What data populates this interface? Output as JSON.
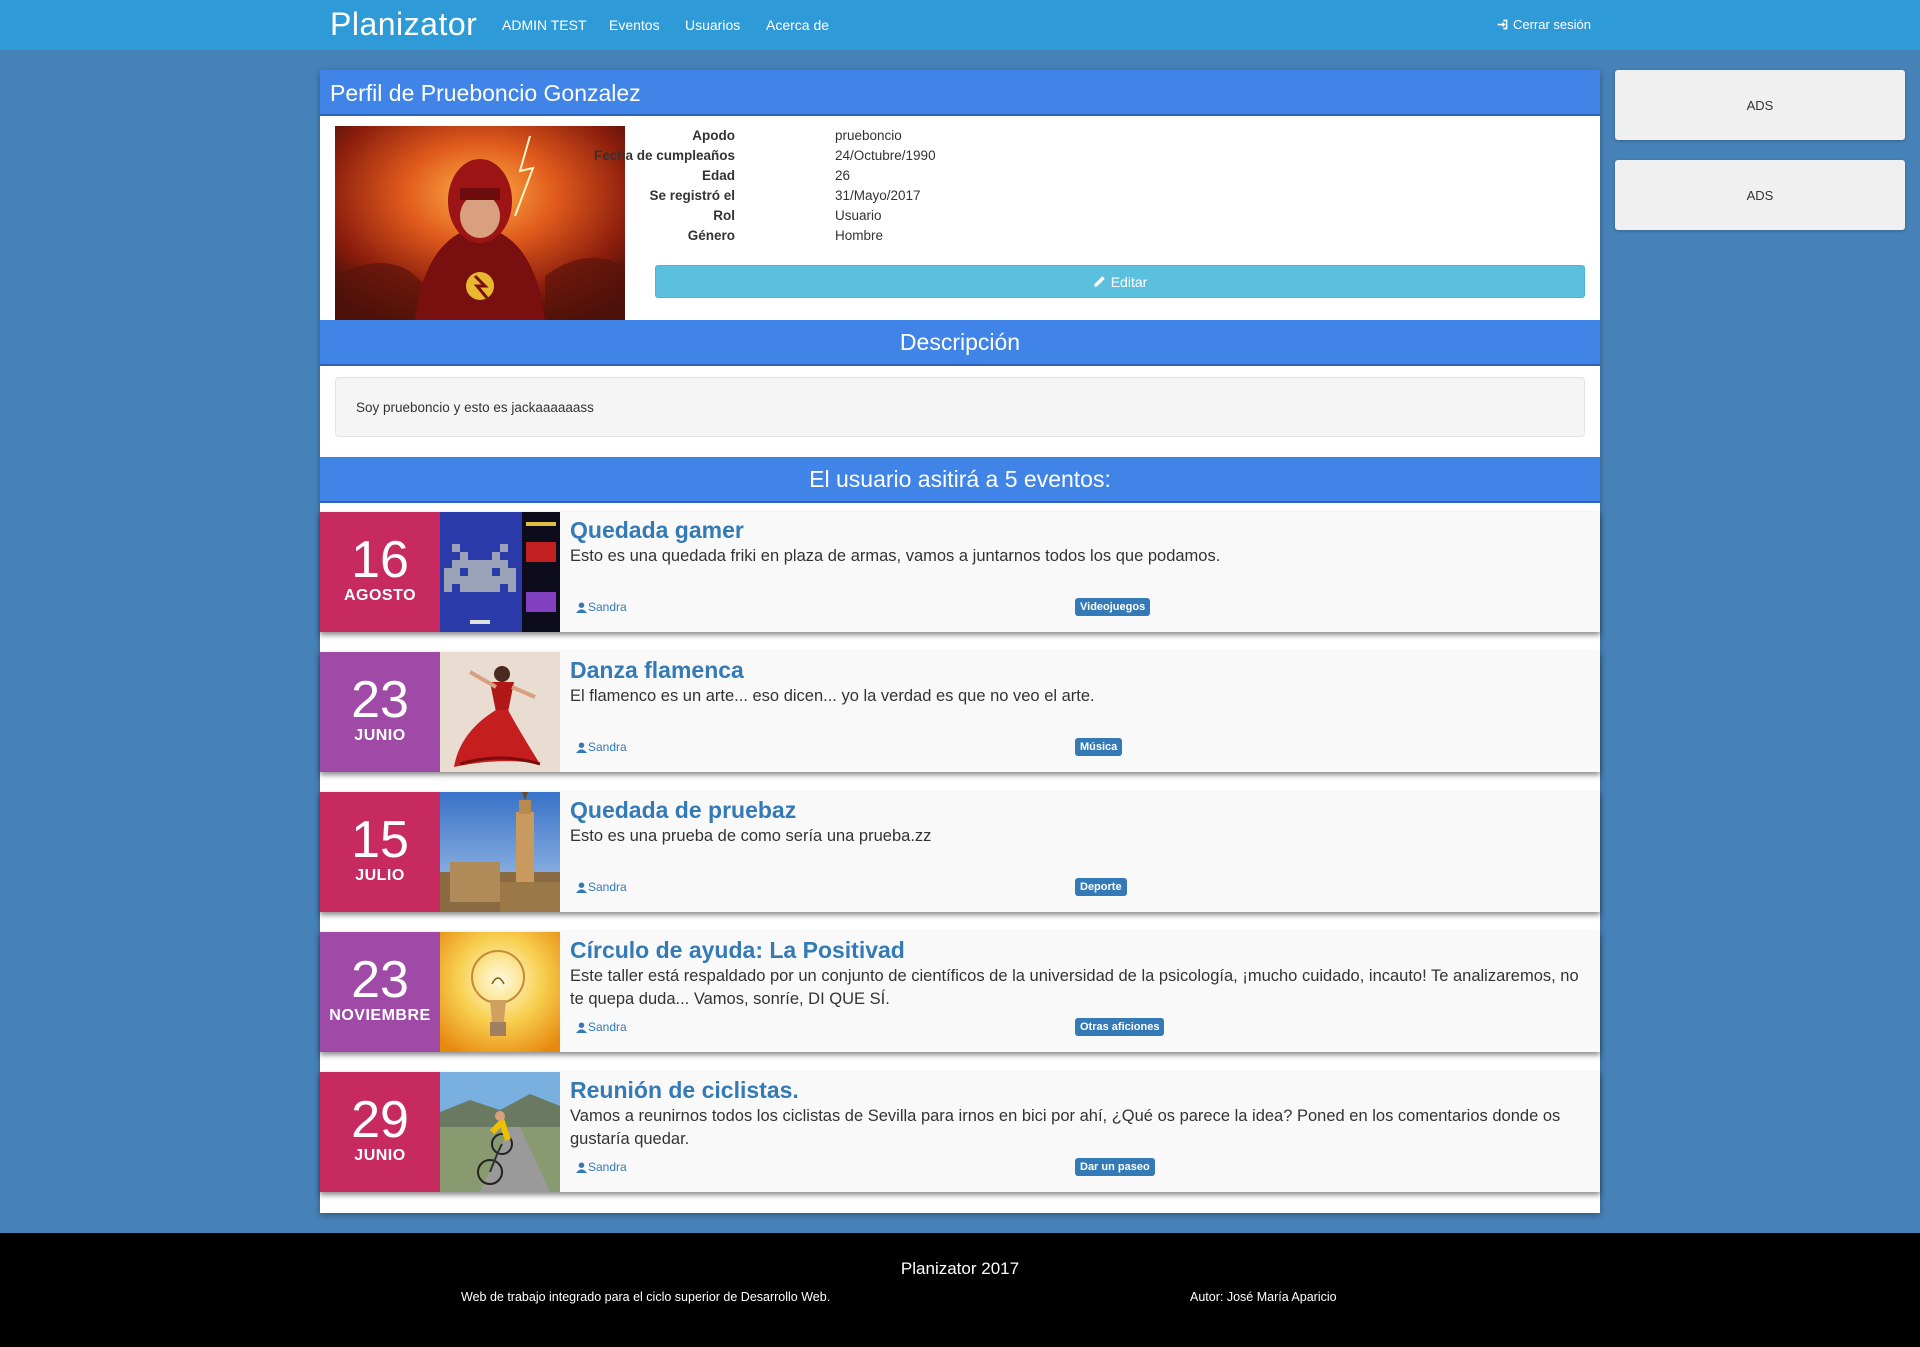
{
  "navbar": {
    "brand": "Planizator",
    "links": [
      "ADMIN TEST",
      "Eventos",
      "Usuarios",
      "Acerca de"
    ],
    "logout": "Cerrar sesión"
  },
  "ads": [
    "ADS",
    "ADS"
  ],
  "profile": {
    "title": "Perfil de Prueboncio Gonzalez",
    "fields": [
      {
        "label": "Apodo",
        "value": "prueboncio"
      },
      {
        "label": "Fecha de cumpleaños",
        "value": "24/Octubre/1990"
      },
      {
        "label": "Edad",
        "value": "26"
      },
      {
        "label": "Se registró el",
        "value": "31/Mayo/2017"
      },
      {
        "label": "Rol",
        "value": "Usuario"
      },
      {
        "label": "Género",
        "value": "Hombre"
      }
    ],
    "edit_label": "Editar"
  },
  "description": {
    "heading": "Descripción",
    "text": "Soy prueboncio y esto es jackaaaaaass"
  },
  "events_section": {
    "heading": "El usuario asitirá a 5 eventos:",
    "events": [
      {
        "day": "16",
        "month": "AGOSTO",
        "color": "#c72a5e",
        "title": "Quedada gamer",
        "desc": "Esto es una quedada friki en plaza de armas, vamos a juntarnos todos los que podamos.",
        "author": "Sandra",
        "tag": "Videojuegos"
      },
      {
        "day": "23",
        "month": "JUNIO",
        "color": "#a04aa8",
        "title": "Danza flamenca",
        "desc": "El flamenco es un arte... eso dicen... yo la verdad es que no veo el arte.",
        "author": "Sandra",
        "tag": "Música"
      },
      {
        "day": "15",
        "month": "JULIO",
        "color": "#c72a5e",
        "title": "Quedada de pruebaz",
        "desc": "Esto es una prueba de como sería una prueba.zz",
        "author": "Sandra",
        "tag": "Deporte"
      },
      {
        "day": "23",
        "month": "NOVIEMBRE",
        "color": "#a04aa8",
        "title": "Círculo de ayuda: La Positivad",
        "desc": "Este taller está respaldado por un conjunto de científicos de la universidad de la psicología, ¡mucho cuidado, incauto! Te analizaremos, no te quepa duda... Vamos, sonríe, DI QUE SÍ.",
        "author": "Sandra",
        "tag": "Otras aficiones"
      },
      {
        "day": "29",
        "month": "JUNIO",
        "color": "#c72a5e",
        "title": "Reunión de ciclistas.",
        "desc": "Vamos a reunirnos todos los ciclistas de Sevilla para irnos en bici por ahí, ¿Qué os parece la idea? Poned en los comentarios donde os gustaría quedar.",
        "author": "Sandra",
        "tag": "Dar un paseo"
      }
    ]
  },
  "footer": {
    "title": "Planizator 2017",
    "left": "Web de trabajo integrado para el ciclo superior de Desarrollo Web.",
    "right": "Autor: José María Aparicio"
  }
}
